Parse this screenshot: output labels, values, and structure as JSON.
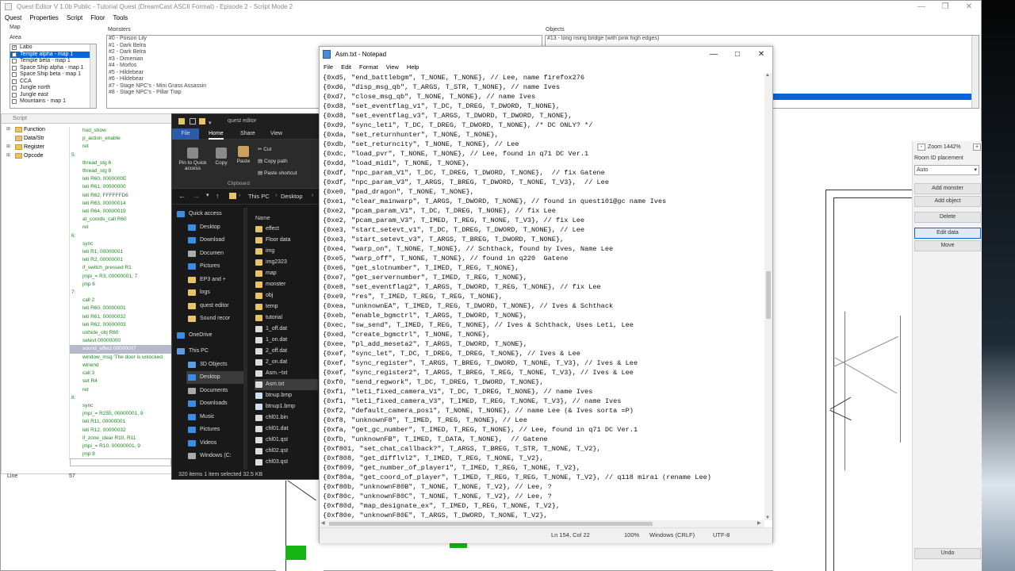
{
  "quest_editor": {
    "title": "Quest Editor V 1.0b Public - Tutorial Quest (DreamCast ASCII Format) - Episode 2 - Script Mode 2",
    "menu": [
      "Quest",
      "Properties",
      "Script",
      "Floor",
      "Tools"
    ],
    "map_label": "Map",
    "area_label": "Area",
    "areas": [
      {
        "label": "Labo",
        "checked": true,
        "selected": false
      },
      {
        "label": "Temple alpha - map 1",
        "checked": true,
        "selected": true
      },
      {
        "label": "Temple beta - map 1",
        "checked": false,
        "selected": false
      },
      {
        "label": "Space Ship alpha - map 1",
        "checked": false,
        "selected": false
      },
      {
        "label": "Space Ship beta - map 1",
        "checked": false,
        "selected": false
      },
      {
        "label": "CCA",
        "checked": false,
        "selected": false
      },
      {
        "label": "Jungle north",
        "checked": false,
        "selected": false
      },
      {
        "label": "Jungle east",
        "checked": false,
        "selected": false
      },
      {
        "label": "Mountains - map 1",
        "checked": false,
        "selected": false
      }
    ],
    "monsters_label": "Monsters",
    "monsters": [
      "#0 - Poison Lily",
      "#1 - Dark Belra",
      "#2 - Dark Belra",
      "#3 - Dimenian",
      "#4 - Morfos",
      "#5 - Hildebear",
      "#6 - Hildebear",
      "#7 - Stage NPC's - Mini Grass Assassin",
      "#8 - Stage NPC's - Pillar Trap"
    ],
    "objects_label": "Objects",
    "objects": [
      "#13 - long rising bridge (with pink high edges)"
    ],
    "script_label": "Script",
    "tree": [
      {
        "label": "Function",
        "expanded": true
      },
      {
        "label": "Data/Str",
        "expanded": false
      },
      {
        "label": "Register",
        "expanded": true
      },
      {
        "label": "Opcode",
        "expanded": true
      }
    ],
    "code_lines": [
      "hud_show",
      "p_action_enable",
      "ret",
      "5:",
      "thread_stg 6",
      "thread_stg 8",
      "leti R60, 0000000E",
      "leti R61, 00000000",
      "leti R62, FFFFFFD6",
      "leti R63, 00000014",
      "leti R64, 00000019",
      "at_coords_call R60",
      "ret",
      "6:",
      "sync",
      "leti R1, 00000001",
      "leti R2, 00000001",
      "if_switch_pressed R1",
      "jmpi_= R3, 00000001, 7",
      "jmp 6",
      "7:",
      "call 2",
      "leti R60, 00000001",
      "leti R61, 00000032",
      "leti R62, 00000003",
      "unhide_obj R60",
      "setevt 00000000",
      "sound_effect 00000007",
      "window_msg 'The door is unlocked",
      "winend",
      "call 3",
      "set R4",
      "ret",
      "8:",
      "sync",
      "jmpi_= R255, 00000001, 9",
      "leti R11, 00000001",
      "leti R12, 00000032",
      "if_zone_clear R10, R11",
      "jmpi_= R10, 00000001, 9",
      "jmp 8"
    ],
    "highlight_code_index": 27,
    "status_line_label": "Line",
    "status_line_value": "57",
    "zoom_label": "Zoom 1442%",
    "room_id_label": "Room ID placement",
    "room_id_value": "Auto",
    "buttons": [
      "Add monster",
      "Add object",
      "Delete",
      "Edit data",
      "Move"
    ],
    "undo_label": "Undo"
  },
  "file_explorer": {
    "title": "quest editor",
    "tabs": [
      "File",
      "Home",
      "Share",
      "View"
    ],
    "ribbon": {
      "pin": "Pin to Quick access",
      "copy": "Copy",
      "paste": "Paste",
      "cut": "Cut",
      "copy_path": "Copy path",
      "paste_shortcut": "Paste shortcut",
      "group": "Clipboard"
    },
    "address": [
      "This PC",
      "Desktop"
    ],
    "nav": [
      {
        "label": "Quick access",
        "color": "#3c8ce7"
      },
      {
        "label": "Desktop",
        "color": "#3c8ce7"
      },
      {
        "label": "Download",
        "color": "#3c8ce7"
      },
      {
        "label": "Documen",
        "color": "#aaaaaa"
      },
      {
        "label": "Pictures",
        "color": "#3c8ce7"
      },
      {
        "label": "EP3 and +",
        "color": "#e7c46a"
      },
      {
        "label": "logs",
        "color": "#e7c46a"
      },
      {
        "label": "quest editor",
        "color": "#e7c46a"
      },
      {
        "label": "Sound recor",
        "color": "#e7c46a"
      },
      {
        "label": "OneDrive",
        "color": "#3c8ce7"
      },
      {
        "label": "This PC",
        "color": "#5aa0e0"
      },
      {
        "label": "3D Objects",
        "color": "#5aa0e0"
      },
      {
        "label": "Desktop",
        "color": "#3c8ce7"
      },
      {
        "label": "Documents",
        "color": "#aaaaaa"
      },
      {
        "label": "Downloads",
        "color": "#3c8ce7"
      },
      {
        "label": "Music",
        "color": "#3c8ce7"
      },
      {
        "label": "Pictures",
        "color": "#3c8ce7"
      },
      {
        "label": "Videos",
        "color": "#3c8ce7"
      },
      {
        "label": "Windows (C:",
        "color": "#aaaaaa"
      }
    ],
    "column_name": "Name",
    "files": [
      {
        "label": "effect",
        "color": "#e7c46a"
      },
      {
        "label": "Floor data",
        "color": "#e7c46a"
      },
      {
        "label": "img",
        "color": "#e7c46a"
      },
      {
        "label": "img2323",
        "color": "#e7c46a"
      },
      {
        "label": "map",
        "color": "#e7c46a"
      },
      {
        "label": "monster",
        "color": "#e7c46a"
      },
      {
        "label": "obj",
        "color": "#e7c46a"
      },
      {
        "label": "temp",
        "color": "#e7c46a"
      },
      {
        "label": "tutorial",
        "color": "#e7c46a"
      },
      {
        "label": "1_off.dat",
        "color": "#dddddd"
      },
      {
        "label": "1_on.dat",
        "color": "#dddddd"
      },
      {
        "label": "2_off.dat",
        "color": "#dddddd"
      },
      {
        "label": "2_on.dat",
        "color": "#dddddd"
      },
      {
        "label": "Asm.~txt",
        "color": "#dddddd"
      },
      {
        "label": "Asm.txt",
        "color": "#dddddd"
      },
      {
        "label": "btnup.bmp",
        "color": "#cfe0f0"
      },
      {
        "label": "btnup1.bmp",
        "color": "#cfe0f0"
      },
      {
        "label": "chl01.bin",
        "color": "#dddddd"
      },
      {
        "label": "chl01.dat",
        "color": "#dddddd"
      },
      {
        "label": "chl01.qst",
        "color": "#dddddd"
      },
      {
        "label": "chl02.qst",
        "color": "#dddddd"
      },
      {
        "label": "chl03.qst",
        "color": "#dddddd"
      }
    ],
    "selected_file_index": 14,
    "status": "320 items    1 item selected  32.5 KB"
  },
  "notepad": {
    "title": "Asm.txt - Notepad",
    "menu": [
      "File",
      "Edit",
      "Format",
      "View",
      "Help"
    ],
    "lines": [
      "{0xd5, \"end_battlebgm\", T_NONE, T_NONE}, // Lee, name firefox276",
      "{0xd6, \"disp_msg_qb\", T_ARGS, T_STR, T_NONE}, // name Ives",
      "{0xd7, \"close_msg_qb\", T_NONE, T_NONE}, // name Ives",
      "{0xd8, \"set_eventflag_v1\", T_DC, T_DREG, T_DWORD, T_NONE},",
      "{0xd8, \"set_eventflag_v3\", T_ARGS, T_DWORD, T_DWORD, T_NONE},",
      "{0xd9, \"sync_leti\", T_DC, T_DREG, T_DWORD, T_NONE}, /* DC ONLY? */",
      "{0xda, \"set_returnhunter\", T_NONE, T_NONE},",
      "{0xdb, \"set_returncity\", T_NONE, T_NONE}, // Lee",
      "{0xdc, \"load_pvr\", T_NONE, T_NONE}, // Lee, found in q71 DC Ver.1",
      "{0xdd, \"load_midi\", T_NONE, T_NONE},",
      "{0xdf, \"npc_param_V1\", T_DC, T_DREG, T_DWORD, T_NONE},  // fix Gatene",
      "{0xdf, \"npc_param_V3\", T_ARGS, T_BREG, T_DWORD, T_NONE, T_V3},  // Lee",
      "{0xe0, \"pad_dragon\", T_NONE, T_NONE},",
      "{0xe1, \"clear_mainwarp\", T_ARGS, T_DWORD, T_NONE}, // found in quest101@gc name Ives",
      "{0xe2, \"pcam_param_V1\", T_DC, T_DREG, T_NONE}, // fix Lee",
      "{0xe2, \"pcam_param_V3\", T_IMED, T_REG, T_NONE, T_V3}, // fix Lee",
      "{0xe3, \"start_setevt_v1\", T_DC, T_DREG, T_DWORD, T_NONE}, // Lee",
      "{0xe3, \"start_setevt_v3\", T_ARGS, T_BREG, T_DWORD, T_NONE},",
      "{0xe4, \"warp_on\", T_NONE, T_NONE}, // Schthack, found by Ives, Name Lee",
      "{0xe5, \"warp_off\", T_NONE, T_NONE}, // found in q220  Gatene",
      "{0xe6, \"get_slotnumber\", T_IMED, T_REG, T_NONE},",
      "{0xe7, \"get_servernumber\", T_IMED, T_REG, T_NONE},",
      "{0xe8, \"set_eventflag2\", T_ARGS, T_DWORD, T_REG, T_NONE}, // fix Lee",
      "{0xe9, \"res\", T_IMED, T_REG, T_REG, T_NONE},",
      "{0xea, \"unknownEA\", T_IMED, T_REG, T_DWORD, T_NONE}, // Ives & Schthack",
      "{0xeb, \"enable_bgmctrl\", T_ARGS, T_DWORD, T_NONE},",
      "{0xec, \"sw_send\", T_IMED, T_REG, T_NONE}, // Ives & Schthack, Uses Leti, Lee",
      "{0xed, \"create_bgmctrl\", T_NONE, T_NONE},",
      "{0xee, \"pl_add_meseta2\", T_ARGS, T_DWORD, T_NONE},",
      "{0xef, \"sync_let\", T_DC, T_DREG, T_DREG, T_NONE}, // Ives & Lee",
      "{0xef, \"sync_register\", T_ARGS, T_BREG, T_DWORD, T_NONE, T_V3}, // Ives & Lee",
      "{0xef, \"sync_register2\", T_ARGS, T_BREG, T_REG, T_NONE, T_V3}, // Ives & Lee",
      "{0xf0, \"send_regwork\", T_DC, T_DREG, T_DWORD, T_NONE},",
      "{0xf1, \"leti_fixed_camera_V1\", T_DC, T_DREG, T_NONE}, // name Ives",
      "{0xf1, \"leti_fixed_camera_V3\", T_IMED, T_REG, T_NONE, T_V3}, // name Ives",
      "{0xf2, \"default_camera_pos1\", T_NONE, T_NONE}, // name Lee (& Ives sorta =P)",
      "{0xf8, \"unknownF8\", T_IMED, T_REG, T_NONE}, // Lee",
      "{0xfa, \"get_gc_number\", T_IMED, T_REG, T_NONE}, // Lee, found in q71 DC Ver.1",
      "{0xfb, \"unknownFB\", T_IMED, T_DATA, T_NONE},  // Gatene",
      "{0xf801, \"set_chat_callback?\", T_ARGS, T_BREG, T_STR, T_NONE, T_V2},",
      "{0xf808, \"get_difflvl2\", T_IMED, T_REG, T_NONE, T_V2},",
      "{0xf809, \"get_number_of_player1\", T_IMED, T_REG, T_NONE, T_V2},",
      "{0xf80a, \"get_coord_of_player\", T_IMED, T_REG, T_REG, T_NONE, T_V2}, // q118 mirai (rename Lee)",
      "{0xf80b, \"unknownF80B\", T_NONE, T_NONE, T_V2}, // Lee, ?",
      "{0xf80c, \"unknownF80C\", T_NONE, T_NONE, T_V2}, // Lee, ?",
      "{0xf80d, \"map_designate_ex\", T_IMED, T_REG, T_NONE, T_V2},",
      "{0xf80e, \"unknownF80E\", T_ARGS, T_DWORD, T_NONE, T_V2},"
    ],
    "status": {
      "position": "Ln 154, Col 22",
      "zoom": "100%",
      "eol": "Windows (CRLF)",
      "encoding": "UTF-8"
    }
  },
  "icons": {
    "minimize": "—",
    "maximize": "□",
    "close": "✕",
    "restore": "❐"
  }
}
